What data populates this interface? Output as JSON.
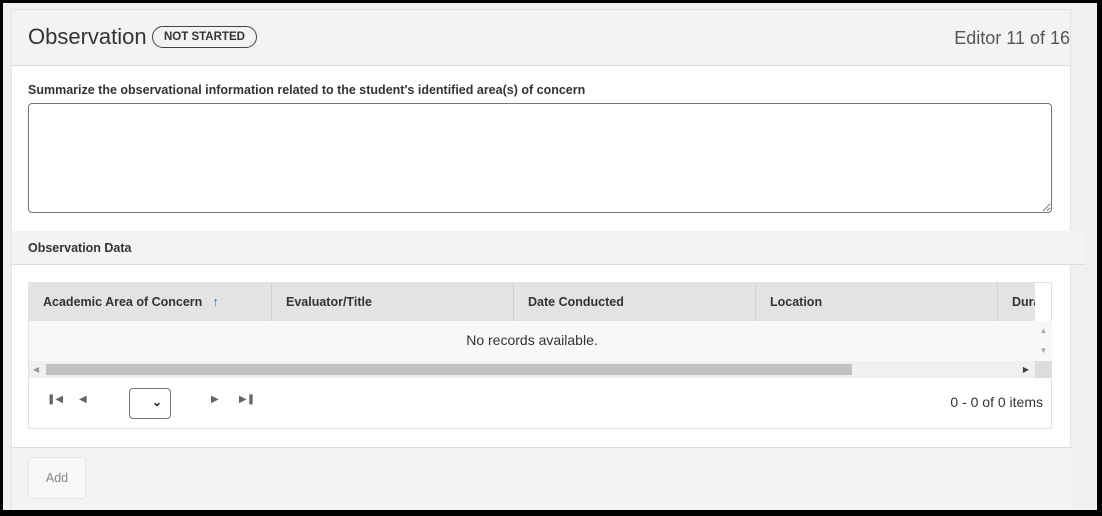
{
  "header": {
    "title": "Observation",
    "status_badge": "NOT STARTED",
    "editor_count": "Editor 11 of 16"
  },
  "summary": {
    "label": "Summarize the observational information related to the student's identified area(s) of concern",
    "value": ""
  },
  "observation_data": {
    "section_title": "Observation Data",
    "columns": [
      {
        "label": "Academic Area of Concern",
        "sorted": "ascending"
      },
      {
        "label": "Evaluator/Title"
      },
      {
        "label": "Date Conducted"
      },
      {
        "label": "Location"
      },
      {
        "label": "Dura"
      }
    ],
    "empty_message": "No records available.",
    "pager": {
      "first_icon": "first-page-icon",
      "prev_icon": "prev-page-icon",
      "next_icon": "next-page-icon",
      "last_icon": "last-page-icon",
      "page_size_value": "",
      "info": "0 - 0 of 0 items"
    }
  },
  "footer": {
    "add_label": "Add"
  }
}
